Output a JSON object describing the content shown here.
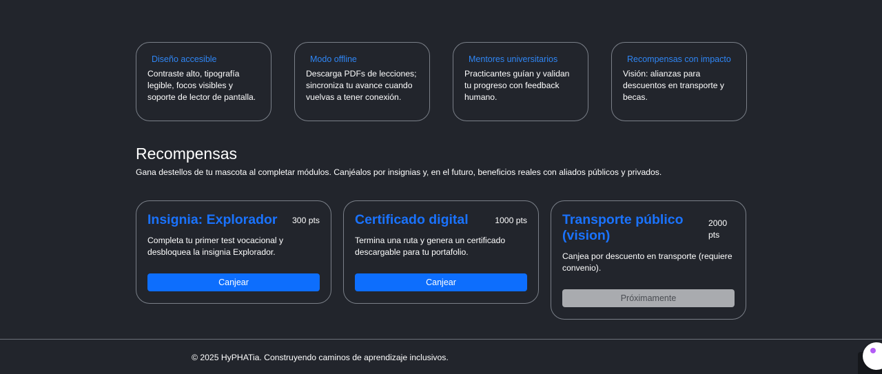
{
  "features": [
    {
      "title": "Diseño accesible",
      "text": "Contraste alto, tipografía legible, focos visibles y soporte de lector de pantalla."
    },
    {
      "title": "Modo offline",
      "text": "Descarga PDFs de lecciones; sincroniza tu avance cuando vuelvas a tener conexión."
    },
    {
      "title": "Mentores universitarios",
      "text": "Practicantes guían y validan tu progreso con feedback humano."
    },
    {
      "title": "Recompensas con impacto",
      "text": "Visión: alianzas para descuentos en transporte y becas."
    }
  ],
  "rewards_section": {
    "title": "Recompensas",
    "description": "Gana destellos de tu mascota al completar módulos. Canjéalos por insignias y, en el futuro, beneficios reales con aliados públicos y privados."
  },
  "rewards": [
    {
      "title": "Insignia: Explorador",
      "points": "300 pts",
      "text": "Completa tu primer test vocacional y desbloquea la insignia Explorador.",
      "button": "Canjear"
    },
    {
      "title": "Certificado digital",
      "points": "1000 pts",
      "text": "Termina una ruta y genera un certificado descargable para tu portafolio.",
      "button": "Canjear"
    },
    {
      "title": "Transporte público (vision)",
      "points": "2000 pts",
      "text": "Canjea por descuento en transporte (requiere convenio).",
      "button": "Próximamente"
    }
  ],
  "footer": {
    "text": "© 2025 HyPHATia. Construyendo caminos de aprendizaje inclusivos."
  },
  "colors": {
    "background": "#22252c",
    "accent": "#0d6efd",
    "feature_title": "#2f86f5",
    "disabled": "#a9abaf"
  }
}
